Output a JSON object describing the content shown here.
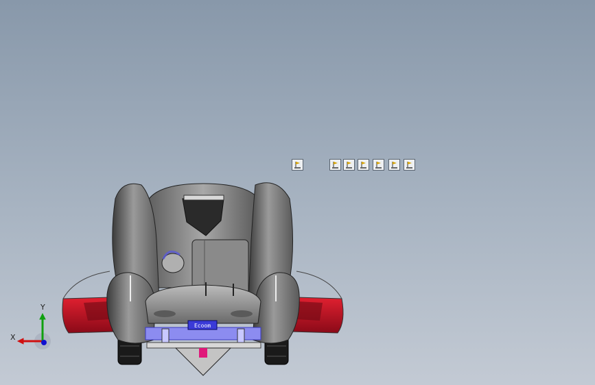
{
  "viewport": {
    "background_top": "#8898aa",
    "background_bottom": "#c3cad4"
  },
  "model": {
    "plate_text": "Ecoom",
    "colors": {
      "body": "#7a7a7a",
      "fender_red": "#c8102e",
      "frame_blue": "#5a5ad8",
      "accent_pink": "#e0187a"
    }
  },
  "annotation_icons": [
    {
      "name": "annotation-flag-icon"
    },
    {
      "name": "annotation-flag-icon"
    },
    {
      "name": "annotation-flag-icon"
    },
    {
      "name": "annotation-flag-icon"
    },
    {
      "name": "annotation-flag-icon"
    },
    {
      "name": "annotation-flag-icon"
    },
    {
      "name": "annotation-flag-icon"
    }
  ],
  "triad": {
    "x_label": "X",
    "y_label": "Y",
    "x_color": "#d01010",
    "y_color": "#10a010",
    "z_color": "#1010d0"
  }
}
